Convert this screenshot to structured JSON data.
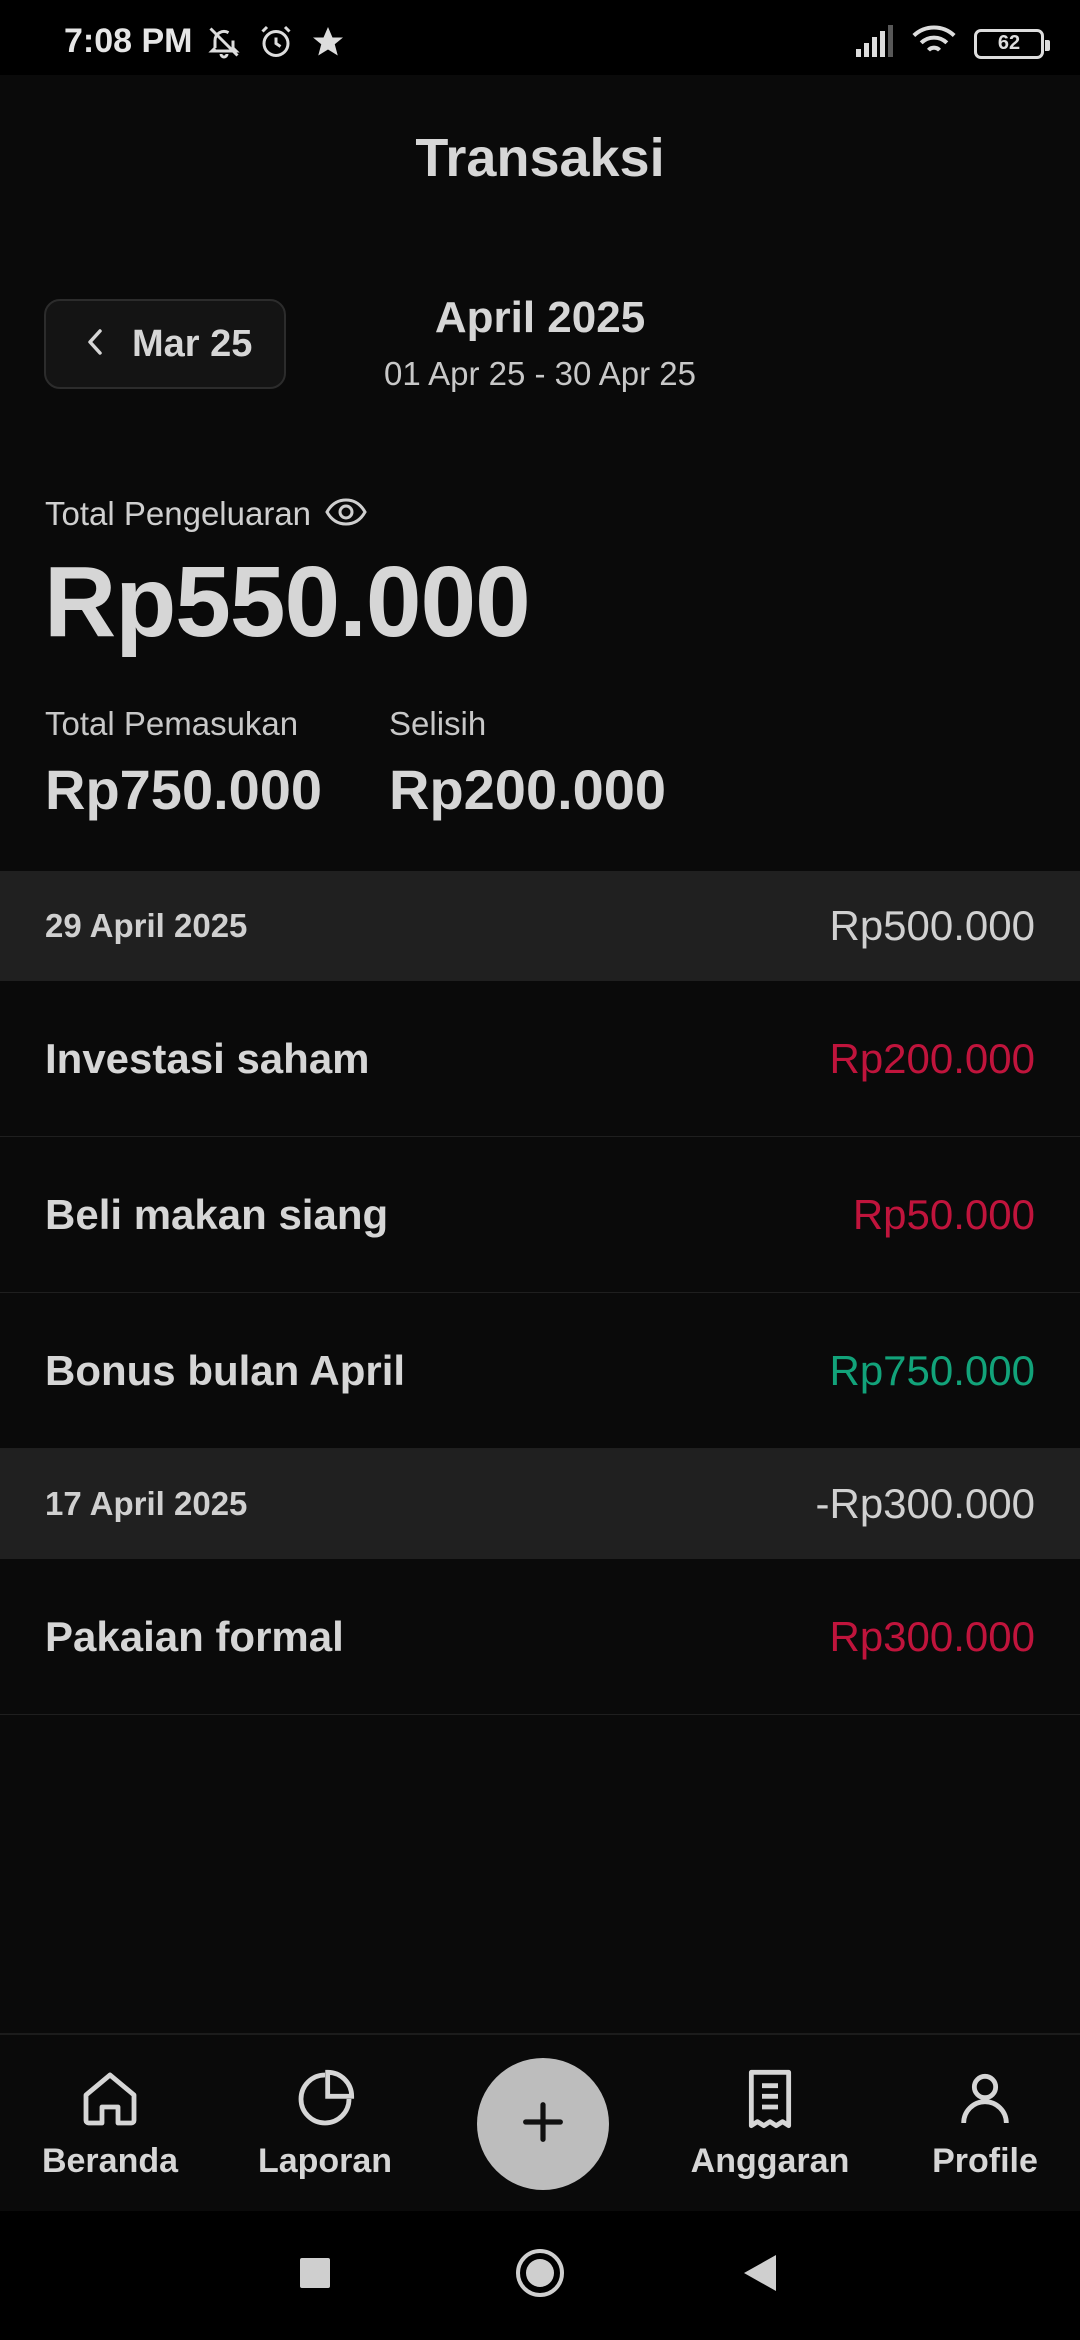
{
  "status_bar": {
    "time": "7:08 PM",
    "battery": "62",
    "icons_left": [
      "notifications-off-icon",
      "alarm-icon",
      "star-icon"
    ],
    "icons_right": [
      "signal-icon",
      "wifi-icon",
      "battery-icon"
    ]
  },
  "header": {
    "title": "Transaksi"
  },
  "period_nav": {
    "prev_label": "Mar 25",
    "current_month": "April 2025",
    "range": "01 Apr 25 - 30 Apr 25"
  },
  "summary": {
    "expense_label": "Total Pengeluaran",
    "expense_value": "Rp550.000",
    "income_label": "Total Pemasukan",
    "income_value": "Rp750.000",
    "diff_label": "Selisih",
    "diff_value": "Rp200.000"
  },
  "groups": [
    {
      "date": "29 April 2025",
      "total": "Rp500.000",
      "items": [
        {
          "name": "Investasi saham",
          "amount": "Rp200.000",
          "type": "expense"
        },
        {
          "name": "Beli makan siang",
          "amount": "Rp50.000",
          "type": "expense"
        },
        {
          "name": "Bonus bulan April",
          "amount": "Rp750.000",
          "type": "income"
        }
      ]
    },
    {
      "date": "17 April 2025",
      "total": "-Rp300.000",
      "items": [
        {
          "name": "Pakaian formal",
          "amount": "Rp300.000",
          "type": "expense"
        }
      ]
    }
  ],
  "bottom_nav": {
    "items": [
      {
        "label": "Beranda",
        "icon": "home-icon"
      },
      {
        "label": "Laporan",
        "icon": "pie-chart-icon"
      },
      {
        "label": "Anggaran",
        "icon": "receipt-icon"
      },
      {
        "label": "Profile",
        "icon": "user-icon"
      }
    ],
    "fab_icon": "plus-icon"
  },
  "colors": {
    "background": "#0a0a0a",
    "expense": "#c0143c",
    "income": "#12a37a",
    "fab": "#bdbdbd"
  }
}
